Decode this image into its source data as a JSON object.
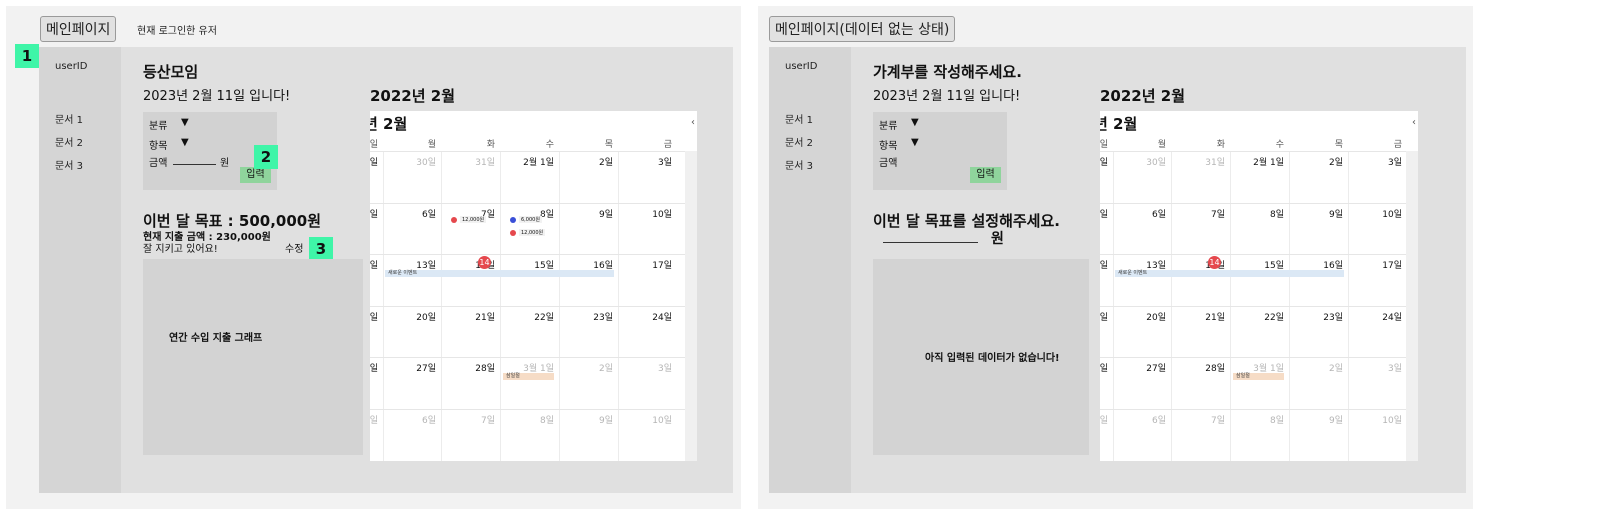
{
  "left": {
    "page_button": "메인페이지",
    "user_label": "현재 로그인한 유저",
    "sidebar": {
      "user": "userID",
      "docs": [
        "문서 1",
        "문서 2",
        "문서 3"
      ]
    },
    "title": "등산모임",
    "date": "2023년 2월 11일 입니다!",
    "form": {
      "category": "분류",
      "item": "항목",
      "amount": "금액",
      "won": "원",
      "submit": "입력"
    },
    "goal": {
      "title": "이번 달 목표 : 500,000원",
      "spent": "현재 지출 금액 : 230,000원",
      "comment": "잘 지키고 있어요!",
      "edit": "수정"
    },
    "graph": "연간 수입 지출 그래프",
    "annotations": [
      "1",
      "2",
      "3"
    ]
  },
  "right": {
    "page_button": "메인페이지(데이터 없는 상태)",
    "sidebar": {
      "user": "userID",
      "docs": [
        "문서 1",
        "문서 2",
        "문서 3"
      ]
    },
    "title": "가계부를 작성해주세요.",
    "date": "2023년 2월 11일 입니다!",
    "form": {
      "category": "분류",
      "item": "항목",
      "amount": "금액",
      "submit": "입력"
    },
    "goal": {
      "title": "이번 달 목표를 설정해주세요.",
      "won": "원"
    },
    "graph": "아직 입력된 데이터가 없습니다!"
  },
  "calendar": {
    "title": "2022년 2월",
    "subtitle": "년 2월",
    "weekdays": [
      "일",
      "월",
      "화",
      "수",
      "목",
      "금"
    ],
    "weeks": [
      [
        "일",
        "30일",
        "31일",
        "2월 1일",
        "2일",
        "3일"
      ],
      [
        "일",
        "6일",
        "7일",
        "8일",
        "9일",
        "10일"
      ],
      [
        "일",
        "13일",
        "14일",
        "15일",
        "16일",
        "17일"
      ],
      [
        "일",
        "20일",
        "21일",
        "22일",
        "23일",
        "24일"
      ],
      [
        "일",
        "27일",
        "28일",
        "3월 1일",
        "2일",
        "3일"
      ],
      [
        "일",
        "6일",
        "7일",
        "8일",
        "9일",
        "10일"
      ]
    ],
    "today": "14",
    "event_span": "새로운 이벤트",
    "holiday": "삼일절",
    "expenses": [
      "12,000원",
      "6,000원",
      "12,000원"
    ],
    "colors": {
      "red": "#e5484d",
      "blue": "#3a4fd8",
      "event": "#dbe8f5",
      "holiday": "#f6dcc6"
    }
  }
}
